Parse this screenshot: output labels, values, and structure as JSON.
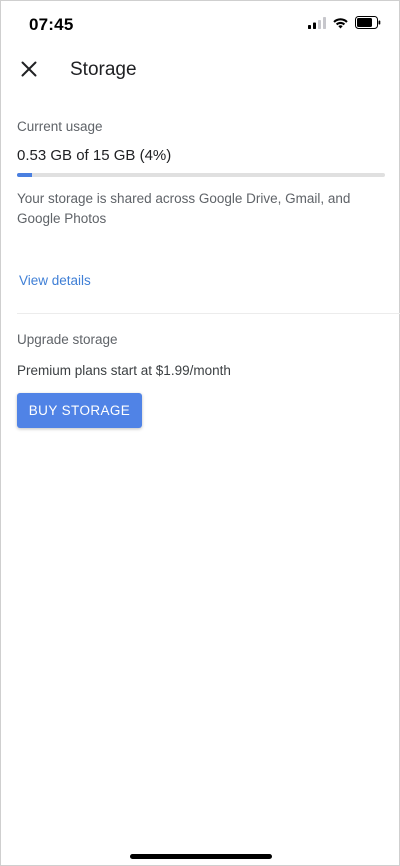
{
  "status_bar": {
    "time": "07:45",
    "icons": [
      "cellular-signal-icon",
      "wifi-icon",
      "battery-icon"
    ]
  },
  "app_bar": {
    "close_icon": "close-icon",
    "title": "Storage"
  },
  "current_usage": {
    "label": "Current usage",
    "value": "0.53 GB of 15 GB (4%)",
    "progress_fraction": 0.04,
    "progress_color": "#4a7fe0",
    "note": "Your storage is shared across Google Drive, Gmail, and Google Photos",
    "view_details_label": "View details"
  },
  "upgrade": {
    "label": "Upgrade storage",
    "note": "Premium plans start at $1.99/month",
    "button_label": "BUY STORAGE",
    "button_color": "#5083e6"
  }
}
